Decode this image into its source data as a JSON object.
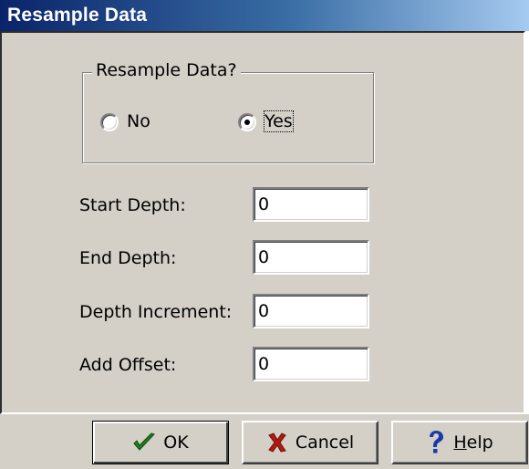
{
  "window": {
    "title": "Resample Data"
  },
  "resample_group": {
    "legend": "Resample Data?",
    "options": [
      {
        "label": "No",
        "selected": false
      },
      {
        "label": "Yes",
        "selected": true
      }
    ]
  },
  "fields": [
    {
      "label": "Start Depth:",
      "value": "0"
    },
    {
      "label": "End Depth:",
      "value": "0"
    },
    {
      "label": "Depth Increment:",
      "value": "0"
    },
    {
      "label": "Add Offset:",
      "value": "0"
    }
  ],
  "buttons": {
    "ok": {
      "label": "OK",
      "icon": "check-icon"
    },
    "cancel": {
      "label": "Cancel",
      "icon": "x-icon"
    },
    "help": {
      "label_prefix": "",
      "label_underlined": "H",
      "label_rest": "elp",
      "icon": "question-icon"
    }
  },
  "colors": {
    "check": "#1b7f1b",
    "cancel_x": "#b21a10",
    "help_q": "#1a3aa8"
  }
}
